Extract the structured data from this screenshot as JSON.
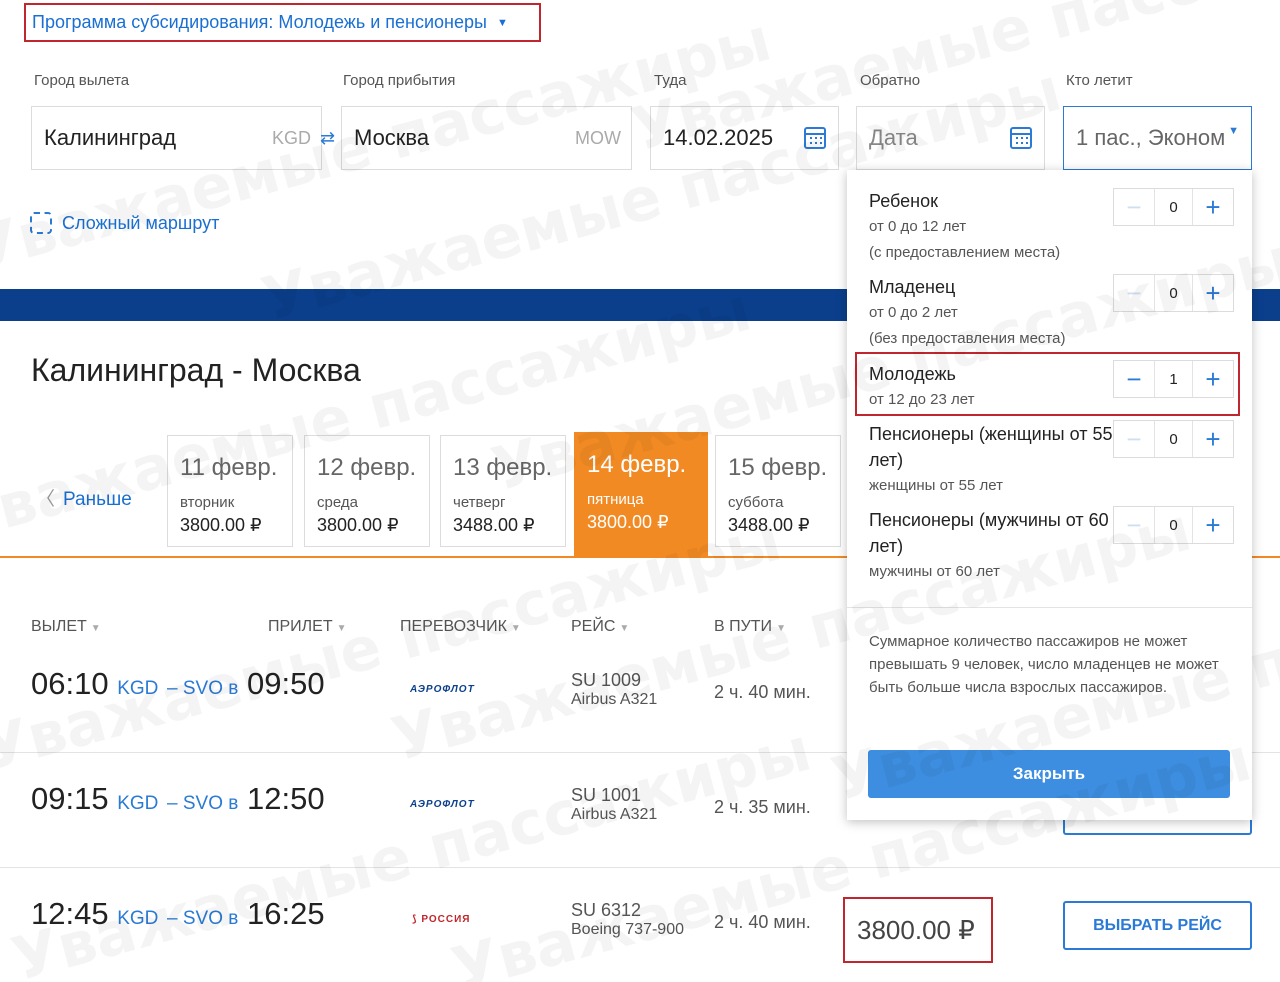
{
  "program": {
    "label": "Программа субсидирования: Молодежь и пенсионеры"
  },
  "search": {
    "from_label": "Город вылета",
    "from_value": "Калининград",
    "from_code": "KGD",
    "to_label": "Город прибытия",
    "to_value": "Москва",
    "to_code": "MOW",
    "depart_label": "Туда",
    "depart_value": "14.02.2025",
    "return_label": "Обратно",
    "return_placeholder": "Дата",
    "pax_label": "Кто летит",
    "pax_value": "1 пас., Эконом",
    "complex_route": "Сложный маршрут"
  },
  "route_title": "Калининград - Москва",
  "earlier": "Раньше",
  "dates": [
    {
      "day": "11 февр.",
      "weekday": "вторник",
      "price": "3800.00 ₽",
      "active": false
    },
    {
      "day": "12 февр.",
      "weekday": "среда",
      "price": "3800.00 ₽",
      "active": false
    },
    {
      "day": "13 февр.",
      "weekday": "четверг",
      "price": "3488.00 ₽",
      "active": false
    },
    {
      "day": "14 февр.",
      "weekday": "пятница",
      "price": "3800.00 ₽",
      "active": true
    },
    {
      "day": "15 февр.",
      "weekday": "суббота",
      "price": "3488.00 ₽",
      "active": false
    }
  ],
  "columns": {
    "departure": "ВЫЛЕТ",
    "arrival": "ПРИЛЕТ",
    "carrier": "ПЕРЕВОЗЧИК",
    "flight": "РЕЙС",
    "duration": "В ПУТИ"
  },
  "flights": [
    {
      "dep_time": "06:10",
      "dep_code": "KGD",
      "sep": "– SVO в",
      "arr_time": "09:50",
      "carrier": "АЭРОФЛОТ",
      "flight_no": "SU 1009",
      "aircraft": "Airbus A321",
      "duration": "2 ч. 40 мин."
    },
    {
      "dep_time": "09:15",
      "dep_code": "KGD",
      "sep": "– SVO в",
      "arr_time": "12:50",
      "carrier": "АЭРОФЛОТ",
      "flight_no": "SU 1001",
      "aircraft": "Airbus A321",
      "duration": "2 ч. 35 мин."
    },
    {
      "dep_time": "12:45",
      "dep_code": "KGD",
      "sep": "– SVO в",
      "arr_time": "16:25",
      "carrier": "РОССИЯ",
      "flight_no": "SU 6312",
      "aircraft": "Boeing 737-900",
      "duration": "2 ч. 40 мин.",
      "price": "3800.00 ₽",
      "select": "ВЫБРАТЬ РЕЙС"
    }
  ],
  "pax_dropdown": {
    "items": [
      {
        "title": "Ребенок",
        "sub1": "от 0 до 12 лет",
        "sub2": "(с предоставлением места)",
        "count": "0"
      },
      {
        "title": "Младенец",
        "sub1": "от 0 до 2 лет",
        "sub2": "(без предоставления места)",
        "count": "0"
      },
      {
        "title": "Молодежь",
        "sub1": "от 12 до 23 лет",
        "sub2": "",
        "count": "1"
      },
      {
        "title": "Пенсионеры (женщины от 55 лет)",
        "sub1": "женщины от 55 лет",
        "sub2": "",
        "count": "0"
      },
      {
        "title": "Пенсионеры (мужчины от 60 лет)",
        "sub1": "мужчины от 60 лет",
        "sub2": "",
        "count": "0"
      }
    ],
    "minus": "−",
    "plus": "+",
    "note": "Суммарное количество пассажиров не может превышать 9 человек, число младенцев не может быть больше числа взрослых пассажиров.",
    "close": "Закрыть"
  },
  "watermark": "Уважаемые пассажиры",
  "colors": {
    "accent": "#2a7ad6",
    "brand_dark": "#0b3f8c",
    "active_date": "#f28a24",
    "highlight": "#c0262d"
  }
}
